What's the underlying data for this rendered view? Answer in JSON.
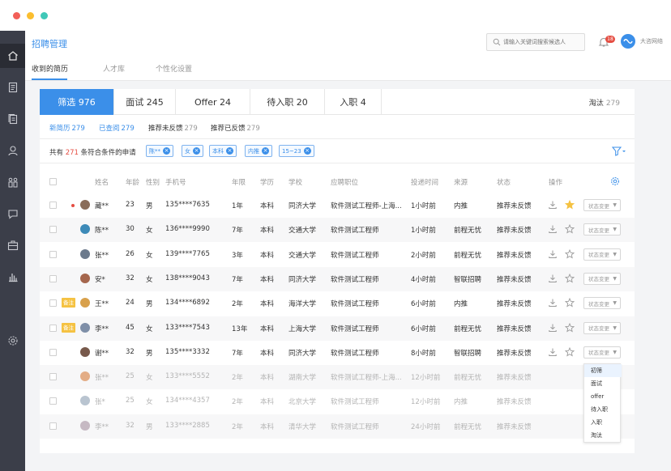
{
  "header": {
    "title": "招聘管理",
    "search_placeholder": "请输入关键词搜索候选人",
    "notification_count": "18",
    "company": "大咨网络"
  },
  "subtabs": [
    "收到的简历",
    "人才库",
    "个性化设置"
  ],
  "stages": [
    {
      "label": "筛选 976"
    },
    {
      "label": "面试 245"
    },
    {
      "label": "Offer 24"
    },
    {
      "label": "待入职 20"
    },
    {
      "label": "入职 4"
    }
  ],
  "reject": {
    "label": "淘汰",
    "count": "279"
  },
  "filter_tabs": [
    {
      "label": "新简历",
      "count": "279"
    },
    {
      "label": "已查阅",
      "count": "279"
    },
    {
      "label": "推荐未反馈",
      "count": "279"
    },
    {
      "label": "推荐已反馈",
      "count": "279"
    }
  ],
  "count_line": {
    "prefix": "共有",
    "count": "271",
    "suffix": "条符合条件的申请"
  },
  "chips": [
    "陈**",
    "女",
    "本科",
    "内推",
    "15~23"
  ],
  "columns": [
    "姓名",
    "年龄",
    "性别",
    "手机号",
    "年限",
    "学历",
    "学校",
    "应聘职位",
    "投递时间",
    "来源",
    "状态",
    "操作"
  ],
  "rows": [
    {
      "name": "藏**",
      "age": "23",
      "gender": "男",
      "phone": "135****7635",
      "years": "1年",
      "edu": "本科",
      "school": "同济大学",
      "job": "软件测试工程师-上海...",
      "time": "1小时前",
      "source": "内推",
      "status": "推荐未反馈",
      "tag": "",
      "dim": false,
      "starred": true,
      "new": true
    },
    {
      "name": "陈**",
      "age": "30",
      "gender": "女",
      "phone": "136****9990",
      "years": "7年",
      "edu": "本科",
      "school": "交通大学",
      "job": "软件测试工程师",
      "time": "1小时前",
      "source": "前程无忧",
      "status": "推荐未反馈",
      "tag": "",
      "dim": false,
      "starred": false,
      "new": false
    },
    {
      "name": "张**",
      "age": "26",
      "gender": "女",
      "phone": "139****7765",
      "years": "3年",
      "edu": "本科",
      "school": "交通大学",
      "job": "软件测试工程师",
      "time": "2小时前",
      "source": "前程无忧",
      "status": "推荐未反馈",
      "tag": "",
      "dim": false,
      "starred": false,
      "new": false
    },
    {
      "name": "安*",
      "age": "32",
      "gender": "女",
      "phone": "138****9043",
      "years": "7年",
      "edu": "本科",
      "school": "同济大学",
      "job": "软件测试工程师",
      "time": "4小时前",
      "source": "智联招聘",
      "status": "推荐未反馈",
      "tag": "",
      "dim": false,
      "starred": false,
      "new": false
    },
    {
      "name": "王**",
      "age": "24",
      "gender": "男",
      "phone": "134****6892",
      "years": "2年",
      "edu": "本科",
      "school": "海洋大学",
      "job": "软件测试工程师",
      "time": "6小时前",
      "source": "内推",
      "status": "推荐未反馈",
      "tag": "备注",
      "dim": false,
      "starred": false,
      "new": false
    },
    {
      "name": "李**",
      "age": "45",
      "gender": "女",
      "phone": "133****7543",
      "years": "13年",
      "edu": "本科",
      "school": "上海大学",
      "job": "软件测试工程师",
      "time": "6小时前",
      "source": "前程无忧",
      "status": "推荐未反馈",
      "tag": "备注",
      "dim": false,
      "starred": false,
      "new": false
    },
    {
      "name": "谢**",
      "age": "32",
      "gender": "男",
      "phone": "135****3332",
      "years": "7年",
      "edu": "本科",
      "school": "同济大学",
      "job": "软件测试工程师",
      "time": "8小时前",
      "source": "智联招聘",
      "status": "推荐未反馈",
      "tag": "",
      "dim": false,
      "starred": false,
      "new": false
    },
    {
      "name": "张**",
      "age": "25",
      "gender": "女",
      "phone": "133****5552",
      "years": "2年",
      "edu": "本科",
      "school": "湖南大学",
      "job": "软件测试工程师-上海...",
      "time": "12小时前",
      "source": "前程无忧",
      "status": "推荐未反馈",
      "tag": "",
      "dim": true,
      "starred": false,
      "new": false
    },
    {
      "name": "张*",
      "age": "25",
      "gender": "女",
      "phone": "134****4357",
      "years": "2年",
      "edu": "本科",
      "school": "北京大学",
      "job": "软件测试工程师",
      "time": "12小时前",
      "source": "内推",
      "status": "推荐未反馈",
      "tag": "",
      "dim": true,
      "starred": false,
      "new": false
    },
    {
      "name": "李**",
      "age": "32",
      "gender": "男",
      "phone": "133****2885",
      "years": "2年",
      "edu": "本科",
      "school": "清华大学",
      "job": "软件测试工程师",
      "time": "24小时前",
      "source": "前程无忧",
      "status": "推荐未反馈",
      "tag": "",
      "dim": true,
      "starred": false,
      "new": false
    }
  ],
  "state_change_label": "状态变更",
  "dropdown_options": [
    "初筛",
    "面试",
    "offer",
    "待入职",
    "入职",
    "淘汰"
  ],
  "colors": {
    "accent": "#3b8fe9",
    "sidebar": "#3b3e49",
    "alert": "#e54d42",
    "note": "#f5c242",
    "star": "#f5c242"
  },
  "avatar_colors": [
    "#8a6d5a",
    "#3d8ab8",
    "#6c7a8c",
    "#a5664d",
    "#d8a04b",
    "#7f8fa8",
    "#77594b",
    "#d67b3a",
    "#8b9cb0",
    "#a58fa0"
  ]
}
